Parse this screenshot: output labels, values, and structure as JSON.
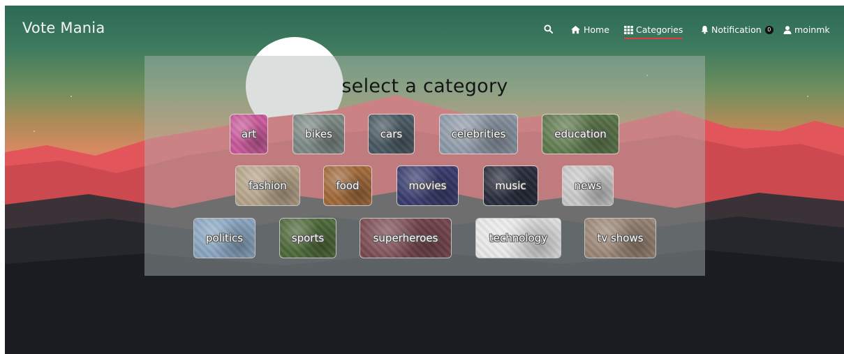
{
  "app": {
    "title": "Vote Mania"
  },
  "nav": {
    "search_icon": "search-icon",
    "home": {
      "label": "Home",
      "icon": "home-icon"
    },
    "categories": {
      "label": "Categories",
      "icon": "grid-icon",
      "active": true
    },
    "notification": {
      "label": "Notification",
      "icon": "bell-icon",
      "count": "0"
    },
    "user": {
      "label": "moinmk",
      "icon": "user-icon"
    }
  },
  "main": {
    "heading": "select a category",
    "categories": [
      {
        "label": "art",
        "color": "#c85a9a"
      },
      {
        "label": "bikes",
        "color": "#7d8a86"
      },
      {
        "label": "cars",
        "color": "#4a5a63"
      },
      {
        "label": "celebrities",
        "color": "#8e9aa8"
      },
      {
        "label": "education",
        "color": "#5f7a4e"
      },
      {
        "label": "fashion",
        "color": "#b6a48a"
      },
      {
        "label": "food",
        "color": "#a06a3c"
      },
      {
        "label": "movies",
        "color": "#3a3e6e"
      },
      {
        "label": "music",
        "color": "#2a2f3e"
      },
      {
        "label": "news",
        "color": "#c9c9c9"
      },
      {
        "label": "politics",
        "color": "#8aa6c0"
      },
      {
        "label": "sports",
        "color": "#4f6a3a"
      },
      {
        "label": "superheroes",
        "color": "#7a4a52"
      },
      {
        "label": "technology",
        "color": "#e8e8e8"
      },
      {
        "label": "tv shows",
        "color": "#9a8676"
      }
    ]
  },
  "colors": {
    "active_underline": "#e23b3b",
    "panel": "#afb9b6",
    "mountain": "#e0555a"
  }
}
